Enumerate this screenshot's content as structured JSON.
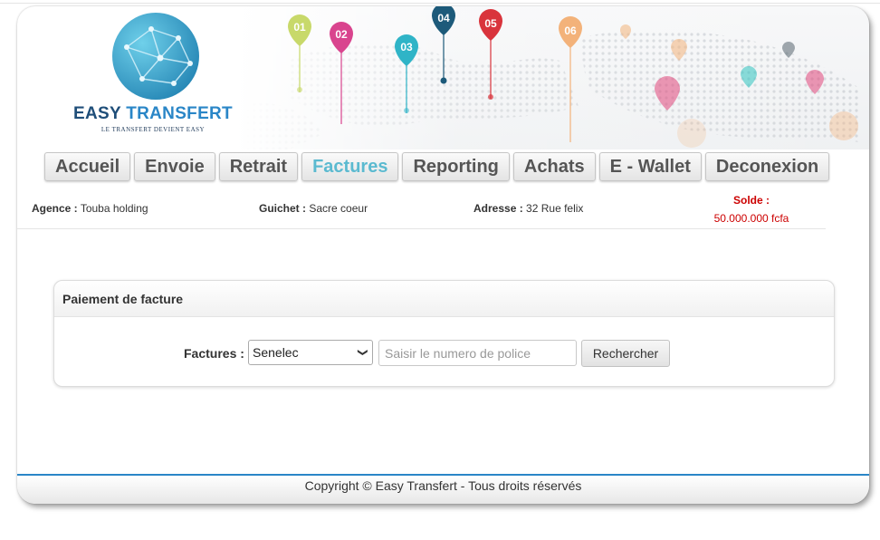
{
  "brand": {
    "name_part1": "EASY ",
    "name_part2": "TRANSFERT",
    "tagline": "LE TRANSFERT DEVIENT EASY"
  },
  "banner": {
    "pins": [
      {
        "label": "01",
        "color": "#c8d96a"
      },
      {
        "label": "02",
        "color": "#d9448e"
      },
      {
        "label": "03",
        "color": "#2fb4c7"
      },
      {
        "label": "04",
        "color": "#1d5a7a"
      },
      {
        "label": "05",
        "color": "#d9343c"
      },
      {
        "label": "06",
        "color": "#f3b27a"
      }
    ]
  },
  "nav": {
    "items": [
      "Accueil",
      "Envoie",
      "Retrait",
      "Factures",
      "Reporting",
      "Achats",
      "E - Wallet",
      "Deconexion"
    ],
    "active": "Factures"
  },
  "info": {
    "agence_label": "Agence :",
    "agence_value": "Touba holding",
    "guichet_label": "Guichet :",
    "guichet_value": "Sacre coeur",
    "adresse_label": "Adresse :",
    "adresse_value": "32 Rue felix",
    "solde_label": "Solde :",
    "solde_value": "50.000.000 fcfa"
  },
  "panel": {
    "title": "Paiement de facture",
    "factures_label": "Factures :",
    "select_value": "Senelec",
    "input_placeholder": "Saisir le numero de police",
    "search_button": "Rechercher"
  },
  "footer": {
    "copyright": "Copyright © Easy Transfert - Tous droits réservés"
  }
}
